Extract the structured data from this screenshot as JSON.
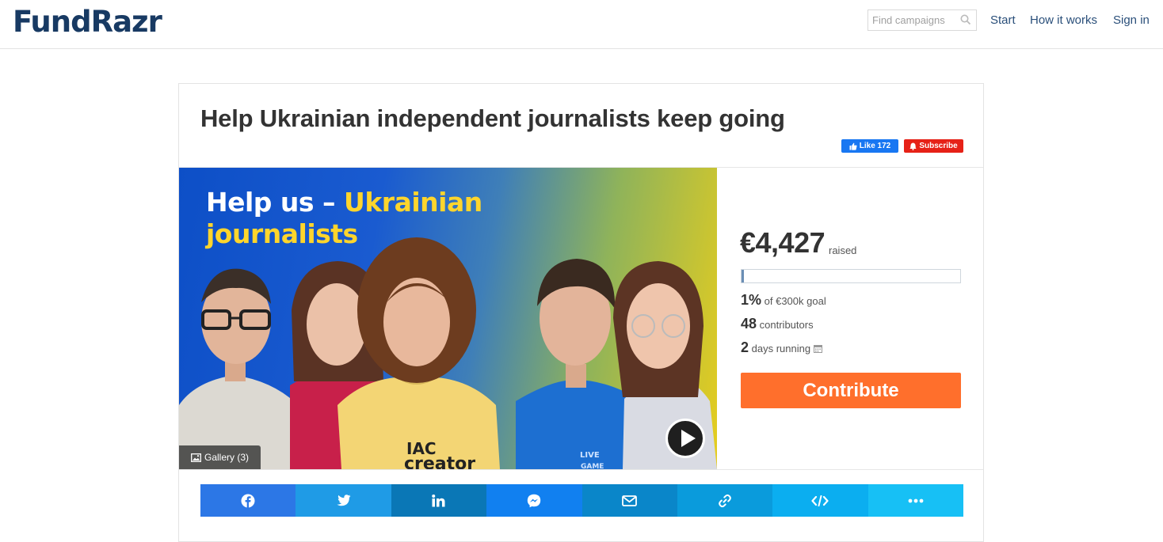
{
  "header": {
    "logo": "FundRazr",
    "search_placeholder": "Find campaigns",
    "nav": {
      "start": "Start",
      "how": "How it works",
      "sign_in": "Sign in"
    }
  },
  "campaign": {
    "title": "Help Ukrainian independent journalists keep going",
    "like_label": "Like 172",
    "subscribe_label": "Subscribe",
    "image_headline_white": "Help us – ",
    "image_headline_yellow1": "Ukrainian",
    "image_headline_yellow2": "journalists",
    "gallery_label": "Gallery (3)"
  },
  "stats": {
    "raised_amount": "€4,427",
    "raised_label": "raised",
    "progress_percent": 1,
    "goal_pct": "1%",
    "goal_label": "of €300k goal",
    "contributors_count": "48",
    "contributors_label": "contributors",
    "days_count": "2",
    "days_label": "days running",
    "contribute_label": "Contribute"
  },
  "share_icons": [
    "facebook-icon",
    "twitter-icon",
    "linkedin-icon",
    "messenger-icon",
    "email-icon",
    "link-icon",
    "embed-code-icon",
    "more-icon"
  ],
  "colors": {
    "brand_navy": "#183a63",
    "contribute_orange": "#ff6f2c",
    "facebook_blue": "#1877f2",
    "youtube_red": "#e62117",
    "headline_yellow": "#ffd52c"
  }
}
